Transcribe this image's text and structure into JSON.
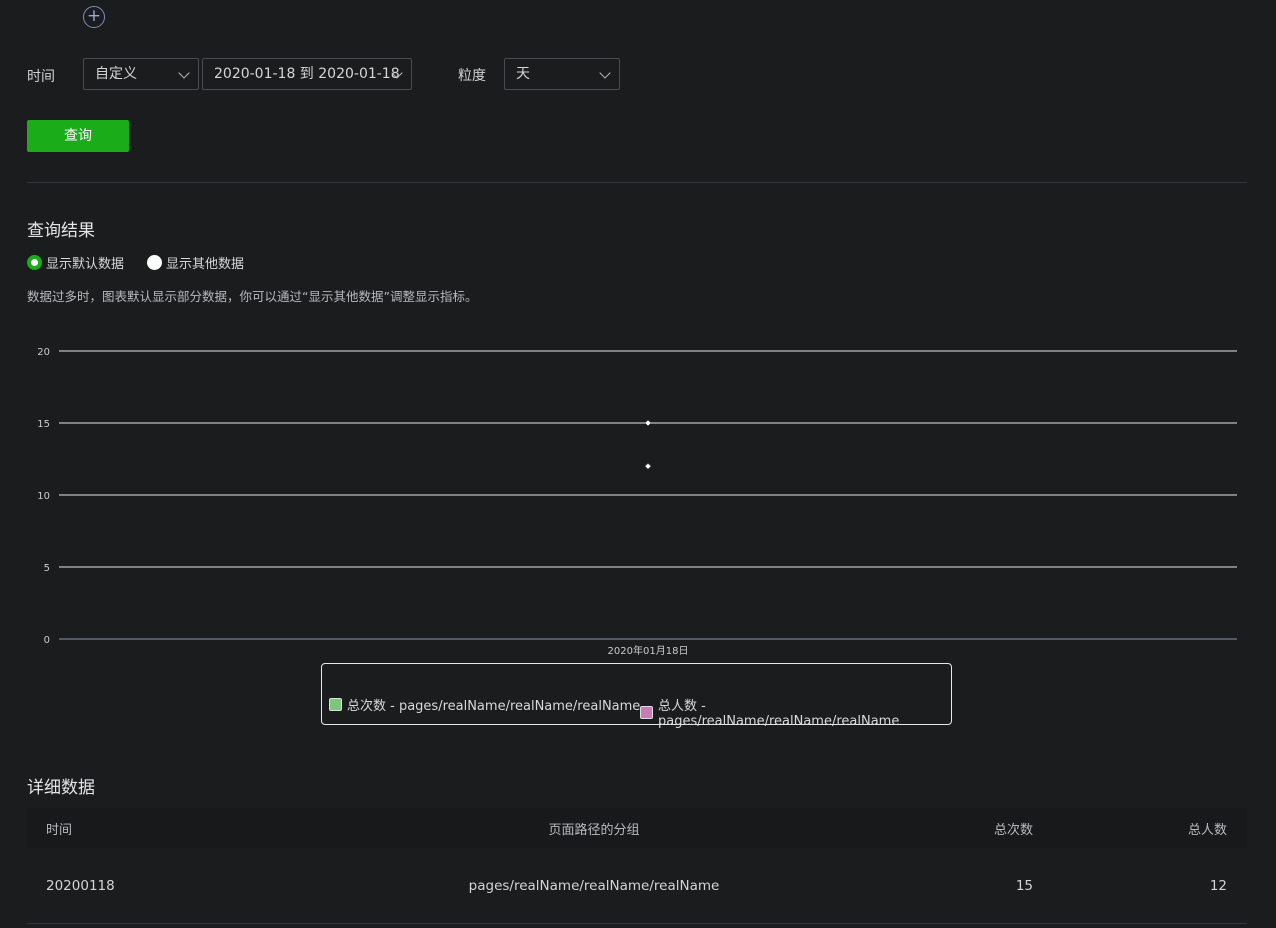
{
  "filters": {
    "time_label": "时间",
    "range_mode": "自定义",
    "date_range": "2020-01-18 到 2020-01-18",
    "granularity_label": "粒度",
    "granularity": "天"
  },
  "query_button": "查询",
  "results": {
    "title": "查询结果",
    "radio_default": "显示默认数据",
    "radio_other": "显示其他数据",
    "hint": "数据过多时，图表默认显示部分数据，你可以通过“显示其他数据”调整显示指标。"
  },
  "chart_data": {
    "type": "line",
    "x": [
      "2020年01月18日"
    ],
    "series": [
      {
        "name": "总次数 - pages/realName/realName/realName",
        "values": [
          15
        ],
        "color": "#7cc77c"
      },
      {
        "name": "总人数 - pages/realName/realName/realName",
        "values": [
          12
        ],
        "color": "#c77cb5"
      }
    ],
    "yticks": [
      "0",
      "5",
      "10",
      "15",
      "20"
    ],
    "ylim": [
      0,
      20
    ],
    "grid": true,
    "legend_position": "bottom-center"
  },
  "details": {
    "title": "详细数据",
    "columns": [
      "时间",
      "页面路径的分组",
      "总次数",
      "总人数"
    ],
    "rows": [
      [
        "20200118",
        "pages/realName/realName/realName",
        "15",
        "12"
      ]
    ]
  }
}
